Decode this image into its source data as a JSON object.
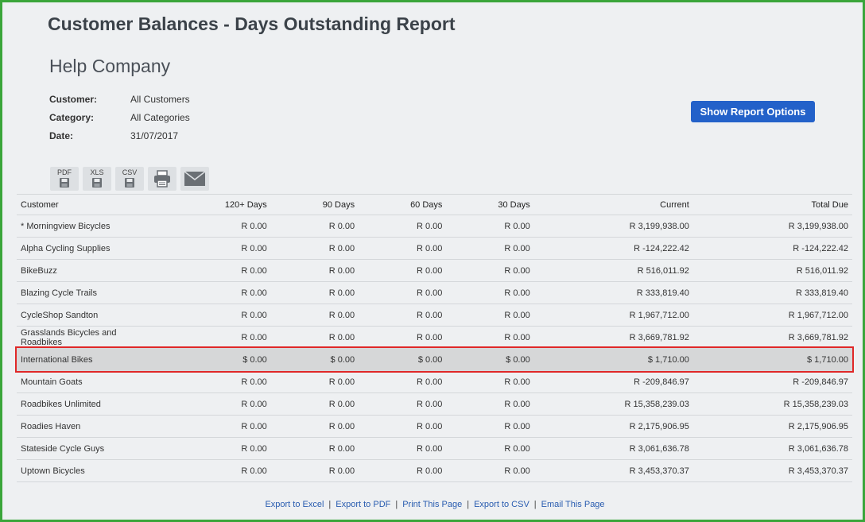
{
  "report_title": "Customer Balances - Days Outstanding Report",
  "company": "Help Company",
  "filters": [
    {
      "label": "Customer:",
      "value": "All Customers"
    },
    {
      "label": "Category:",
      "value": "All Categories"
    },
    {
      "label": "Date:",
      "value": "31/07/2017"
    }
  ],
  "show_options_label": "Show Report Options",
  "export_icons": {
    "pdf": "PDF",
    "xls": "XLS",
    "csv": "CSV",
    "print": "printer-icon",
    "email": "envelope-icon"
  },
  "table": {
    "headers": [
      "Customer",
      "120+ Days",
      "90 Days",
      "60 Days",
      "30 Days",
      "Current",
      "Total Due"
    ],
    "rows": [
      [
        "* Morningview Bicycles",
        "R 0.00",
        "R 0.00",
        "R 0.00",
        "R 0.00",
        "R 3,199,938.00",
        "R 3,199,938.00"
      ],
      [
        "Alpha Cycling Supplies",
        "R 0.00",
        "R 0.00",
        "R 0.00",
        "R 0.00",
        "R -124,222.42",
        "R -124,222.42"
      ],
      [
        "BikeBuzz",
        "R 0.00",
        "R 0.00",
        "R 0.00",
        "R 0.00",
        "R 516,011.92",
        "R 516,011.92"
      ],
      [
        "Blazing Cycle Trails",
        "R 0.00",
        "R 0.00",
        "R 0.00",
        "R 0.00",
        "R 333,819.40",
        "R 333,819.40"
      ],
      [
        "CycleShop Sandton",
        "R 0.00",
        "R 0.00",
        "R 0.00",
        "R 0.00",
        "R 1,967,712.00",
        "R 1,967,712.00"
      ],
      [
        "Grasslands Bicycles and Roadbikes",
        "R 0.00",
        "R 0.00",
        "R 0.00",
        "R 0.00",
        "R 3,669,781.92",
        "R 3,669,781.92"
      ],
      [
        "International Bikes",
        "$ 0.00",
        "$ 0.00",
        "$ 0.00",
        "$ 0.00",
        "$ 1,710.00",
        "$ 1,710.00"
      ],
      [
        "Mountain Goats",
        "R 0.00",
        "R 0.00",
        "R 0.00",
        "R 0.00",
        "R -209,846.97",
        "R -209,846.97"
      ],
      [
        "Roadbikes Unlimited",
        "R 0.00",
        "R 0.00",
        "R 0.00",
        "R 0.00",
        "R 15,358,239.03",
        "R 15,358,239.03"
      ],
      [
        "Roadies Haven",
        "R 0.00",
        "R 0.00",
        "R 0.00",
        "R 0.00",
        "R 2,175,906.95",
        "R 2,175,906.95"
      ],
      [
        "Stateside Cycle Guys",
        "R 0.00",
        "R 0.00",
        "R 0.00",
        "R 0.00",
        "R 3,061,636.78",
        "R 3,061,636.78"
      ],
      [
        "Uptown Bicycles",
        "R 0.00",
        "R 0.00",
        "R 0.00",
        "R 0.00",
        "R 3,453,370.37",
        "R 3,453,370.37"
      ]
    ],
    "highlighted_row": 6
  },
  "footer_links": [
    "Export to Excel",
    "Export to PDF",
    "Print This Page",
    "Export to CSV",
    "Email This Page"
  ],
  "colors": {
    "frame": "#3aa53a",
    "button": "#2361c9",
    "highlight_border": "#e02828"
  }
}
